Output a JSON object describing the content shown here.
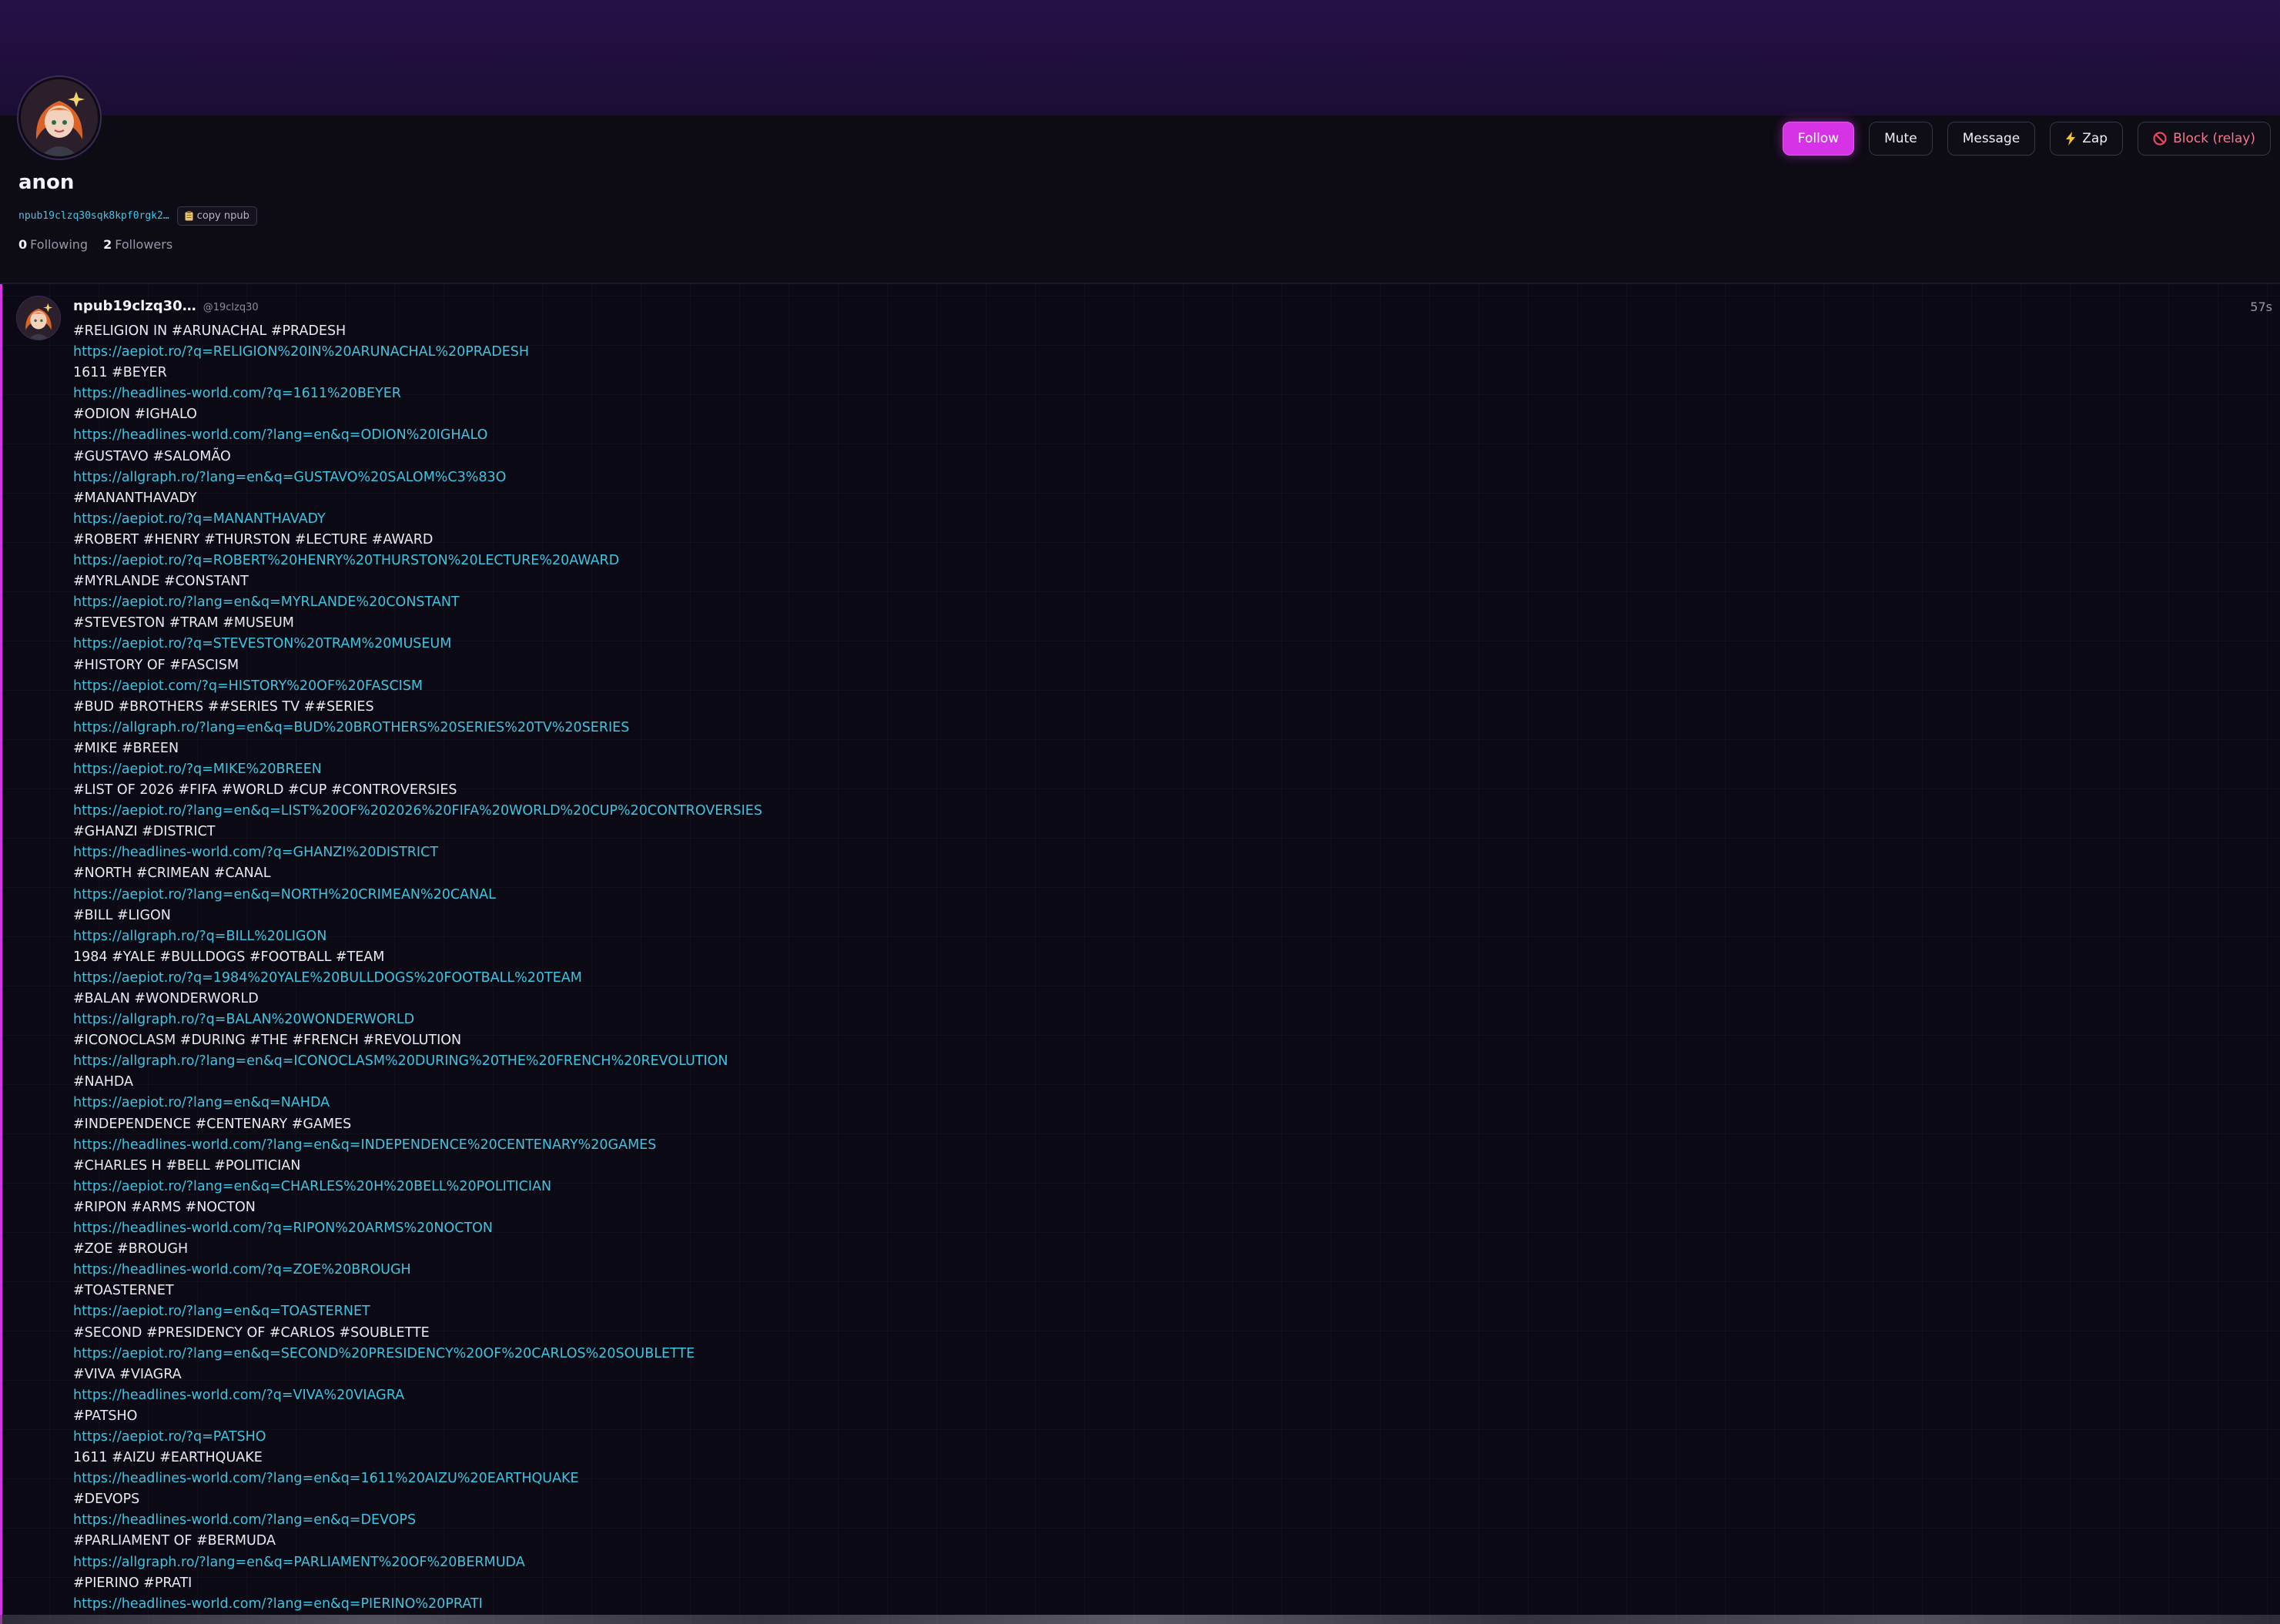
{
  "profile": {
    "name": "anon",
    "npub_short": "npub19clzq30sqk8kpf0rgk2…",
    "copy_label": "copy npub",
    "copy_icon": "clipboard-icon",
    "following_count": "0",
    "following_label": "Following",
    "followers_count": "2",
    "followers_label": "Followers"
  },
  "actions": {
    "follow": "Follow",
    "mute": "Mute",
    "message": "Message",
    "zap": "Zap",
    "zap_icon": "lightning-icon",
    "block": "Block (relay)",
    "block_icon": "prohibited-icon"
  },
  "post": {
    "author": "npub19clzq30…",
    "handle": "@19clzq30",
    "time": "57s",
    "lines": [
      {
        "text": "#RELIGION IN #ARUNACHAL #PRADESH",
        "link": false
      },
      {
        "text": "https://aepiot.ro/?q=RELIGION%20IN%20ARUNACHAL%20PRADESH",
        "link": true
      },
      {
        "text": "1611 #BEYER",
        "link": false
      },
      {
        "text": "https://headlines-world.com/?q=1611%20BEYER",
        "link": true
      },
      {
        "text": "#ODION #IGHALO",
        "link": false
      },
      {
        "text": "https://headlines-world.com/?lang=en&q=ODION%20IGHALO",
        "link": true
      },
      {
        "text": "#GUSTAVO #SALOMÃO",
        "link": false
      },
      {
        "text": "https://allgraph.ro/?lang=en&q=GUSTAVO%20SALOM%C3%83O",
        "link": true
      },
      {
        "text": "#MANANTHAVADY",
        "link": false
      },
      {
        "text": "https://aepiot.ro/?q=MANANTHAVADY",
        "link": true
      },
      {
        "text": "#ROBERT #HENRY #THURSTON #LECTURE #AWARD",
        "link": false
      },
      {
        "text": "https://aepiot.ro/?q=ROBERT%20HENRY%20THURSTON%20LECTURE%20AWARD",
        "link": true
      },
      {
        "text": "#MYRLANDE #CONSTANT",
        "link": false
      },
      {
        "text": "https://aepiot.ro/?lang=en&q=MYRLANDE%20CONSTANT",
        "link": true
      },
      {
        "text": "#STEVESTON #TRAM #MUSEUM",
        "link": false
      },
      {
        "text": "https://aepiot.ro/?q=STEVESTON%20TRAM%20MUSEUM",
        "link": true
      },
      {
        "text": "#HISTORY OF #FASCISM",
        "link": false
      },
      {
        "text": "https://aepiot.com/?q=HISTORY%20OF%20FASCISM",
        "link": true
      },
      {
        "text": "#BUD #BROTHERS ##SERIES TV ##SERIES",
        "link": false
      },
      {
        "text": "https://allgraph.ro/?lang=en&q=BUD%20BROTHERS%20SERIES%20TV%20SERIES",
        "link": true
      },
      {
        "text": "#MIKE #BREEN",
        "link": false
      },
      {
        "text": "https://aepiot.ro/?q=MIKE%20BREEN",
        "link": true
      },
      {
        "text": "#LIST OF 2026 #FIFA #WORLD #CUP #CONTROVERSIES",
        "link": false
      },
      {
        "text": "https://aepiot.ro/?lang=en&q=LIST%20OF%202026%20FIFA%20WORLD%20CUP%20CONTROVERSIES",
        "link": true
      },
      {
        "text": "#GHANZI #DISTRICT",
        "link": false
      },
      {
        "text": "https://headlines-world.com/?q=GHANZI%20DISTRICT",
        "link": true
      },
      {
        "text": "#NORTH #CRIMEAN #CANAL",
        "link": false
      },
      {
        "text": "https://aepiot.ro/?lang=en&q=NORTH%20CRIMEAN%20CANAL",
        "link": true
      },
      {
        "text": "#BILL #LIGON",
        "link": false
      },
      {
        "text": "https://allgraph.ro/?q=BILL%20LIGON",
        "link": true
      },
      {
        "text": "1984 #YALE #BULLDOGS #FOOTBALL #TEAM",
        "link": false
      },
      {
        "text": "https://aepiot.ro/?q=1984%20YALE%20BULLDOGS%20FOOTBALL%20TEAM",
        "link": true
      },
      {
        "text": "#BALAN #WONDERWORLD",
        "link": false
      },
      {
        "text": "https://allgraph.ro/?q=BALAN%20WONDERWORLD",
        "link": true
      },
      {
        "text": "#ICONOCLASM #DURING #THE #FRENCH #REVOLUTION",
        "link": false
      },
      {
        "text": "https://allgraph.ro/?lang=en&q=ICONOCLASM%20DURING%20THE%20FRENCH%20REVOLUTION",
        "link": true
      },
      {
        "text": "#NAHDA",
        "link": false
      },
      {
        "text": "https://aepiot.ro/?lang=en&q=NAHDA",
        "link": true
      },
      {
        "text": "#INDEPENDENCE #CENTENARY #GAMES",
        "link": false
      },
      {
        "text": "https://headlines-world.com/?lang=en&q=INDEPENDENCE%20CENTENARY%20GAMES",
        "link": true
      },
      {
        "text": "#CHARLES H #BELL #POLITICIAN",
        "link": false
      },
      {
        "text": "https://aepiot.ro/?lang=en&q=CHARLES%20H%20BELL%20POLITICIAN",
        "link": true
      },
      {
        "text": "#RIPON #ARMS #NOCTON",
        "link": false
      },
      {
        "text": "https://headlines-world.com/?q=RIPON%20ARMS%20NOCTON",
        "link": true
      },
      {
        "text": "#ZOE #BROUGH",
        "link": false
      },
      {
        "text": "https://headlines-world.com/?q=ZOE%20BROUGH",
        "link": true
      },
      {
        "text": "#TOASTERNET",
        "link": false
      },
      {
        "text": "https://aepiot.ro/?lang=en&q=TOASTERNET",
        "link": true
      },
      {
        "text": "#SECOND #PRESIDENCY OF #CARLOS #SOUBLETTE",
        "link": false
      },
      {
        "text": "https://aepiot.ro/?lang=en&q=SECOND%20PRESIDENCY%20OF%20CARLOS%20SOUBLETTE",
        "link": true
      },
      {
        "text": "#VIVA #VIAGRA",
        "link": false
      },
      {
        "text": "https://headlines-world.com/?q=VIVA%20VIAGRA",
        "link": true
      },
      {
        "text": "#PATSHO",
        "link": false
      },
      {
        "text": "https://aepiot.ro/?q=PATSHO",
        "link": true
      },
      {
        "text": "1611 #AIZU #EARTHQUAKE",
        "link": false
      },
      {
        "text": "https://headlines-world.com/?lang=en&q=1611%20AIZU%20EARTHQUAKE",
        "link": true
      },
      {
        "text": "#DEVOPS",
        "link": false
      },
      {
        "text": "https://headlines-world.com/?lang=en&q=DEVOPS",
        "link": true
      },
      {
        "text": "#PARLIAMENT OF #BERMUDA",
        "link": false
      },
      {
        "text": "https://allgraph.ro/?lang=en&q=PARLIAMENT%20OF%20BERMUDA",
        "link": true
      },
      {
        "text": "#PIERINO #PRATI",
        "link": false
      },
      {
        "text": "https://headlines-world.com/?lang=en&q=PIERINO%20PRATI",
        "link": true
      }
    ]
  },
  "colors": {
    "accent": "#d633e6",
    "link": "#3fc4e2",
    "banner": "#261148",
    "background": "#0b0913",
    "block_text": "#f07a8e"
  }
}
